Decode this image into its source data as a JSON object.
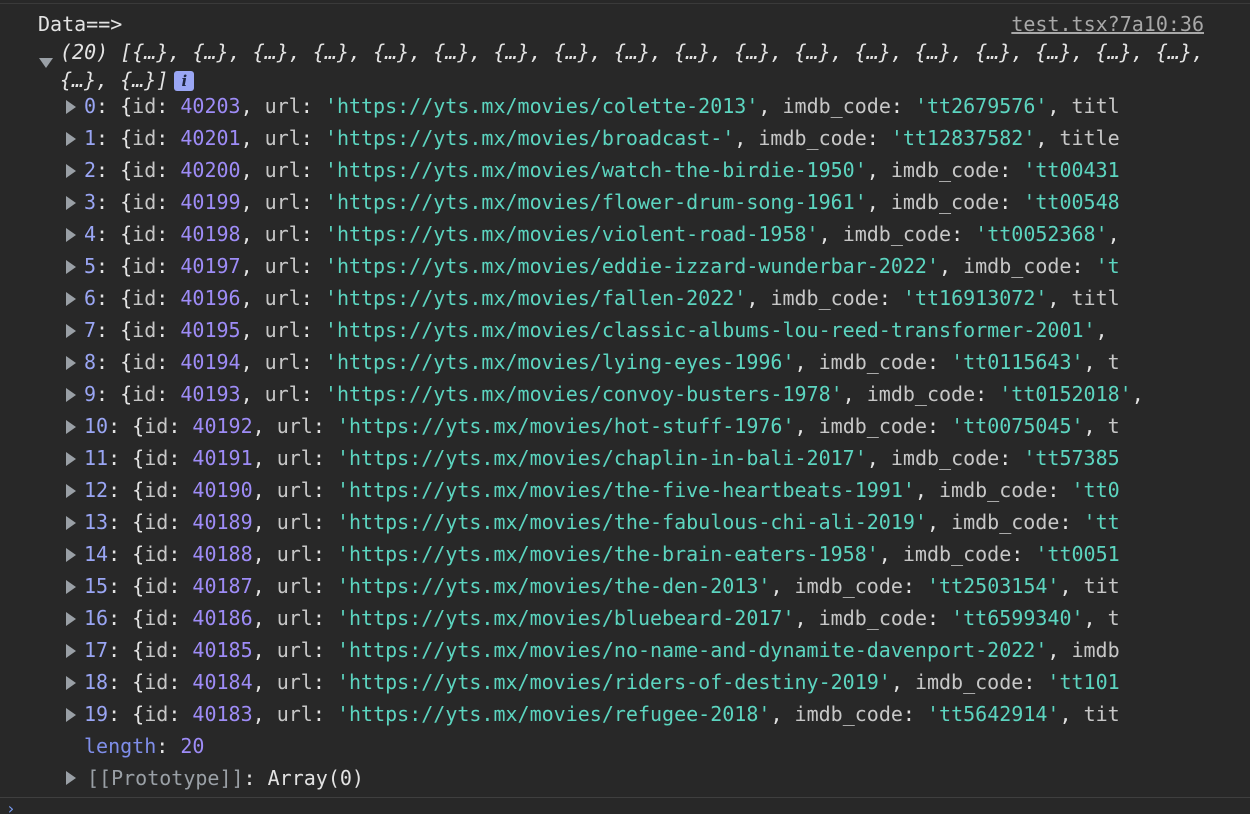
{
  "console": {
    "log_label": "Data==>",
    "source_link": "test.tsx?7a10:36",
    "array_summary": "(20) [{…}, {…}, {…}, {…}, {…}, {…}, {…}, {…}, {…}, {…}, {…}, {…}, {…}, {…}, {…}, {…}, {…}, {…}, {…}, {…}]",
    "info_icon": "info-icon",
    "prompt_icon": "chevron-right-icon",
    "items": [
      {
        "index": "0",
        "id": "40203",
        "url": "https://yts.mx/movies/colette-2013",
        "imdb_code": "tt2679576",
        "tail": "titl"
      },
      {
        "index": "1",
        "id": "40201",
        "url": "https://yts.mx/movies/broadcast-",
        "imdb_code": "tt12837582",
        "tail": "title"
      },
      {
        "index": "2",
        "id": "40200",
        "url": "https://yts.mx/movies/watch-the-birdie-1950",
        "imdb_code": "tt00431",
        "tail": ""
      },
      {
        "index": "3",
        "id": "40199",
        "url": "https://yts.mx/movies/flower-drum-song-1961",
        "imdb_code": "tt00548",
        "tail": ""
      },
      {
        "index": "4",
        "id": "40198",
        "url": "https://yts.mx/movies/violent-road-1958",
        "imdb_code": "tt0052368",
        "tail": ""
      },
      {
        "index": "5",
        "id": "40197",
        "url": "https://yts.mx/movies/eddie-izzard-wunderbar-2022",
        "imdb_code": "t",
        "tail": ""
      },
      {
        "index": "6",
        "id": "40196",
        "url": "https://yts.mx/movies/fallen-2022",
        "imdb_code": "tt16913072",
        "tail": "titl"
      },
      {
        "index": "7",
        "id": "40195",
        "url": "https://yts.mx/movies/classic-albums-lou-reed-transformer-2001",
        "imdb_code": "",
        "tail": ""
      },
      {
        "index": "8",
        "id": "40194",
        "url": "https://yts.mx/movies/lying-eyes-1996",
        "imdb_code": "tt0115643",
        "tail": "t"
      },
      {
        "index": "9",
        "id": "40193",
        "url": "https://yts.mx/movies/convoy-busters-1978",
        "imdb_code": "tt0152018",
        "tail": ""
      },
      {
        "index": "10",
        "id": "40192",
        "url": "https://yts.mx/movies/hot-stuff-1976",
        "imdb_code": "tt0075045",
        "tail": "t"
      },
      {
        "index": "11",
        "id": "40191",
        "url": "https://yts.mx/movies/chaplin-in-bali-2017",
        "imdb_code": "tt57385",
        "tail": ""
      },
      {
        "index": "12",
        "id": "40190",
        "url": "https://yts.mx/movies/the-five-heartbeats-1991",
        "imdb_code": "tt0",
        "tail": ""
      },
      {
        "index": "13",
        "id": "40189",
        "url": "https://yts.mx/movies/the-fabulous-chi-ali-2019",
        "imdb_code": "tt",
        "tail": ""
      },
      {
        "index": "14",
        "id": "40188",
        "url": "https://yts.mx/movies/the-brain-eaters-1958",
        "imdb_code": "tt0051",
        "tail": ""
      },
      {
        "index": "15",
        "id": "40187",
        "url": "https://yts.mx/movies/the-den-2013",
        "imdb_code": "tt2503154",
        "tail": "tit"
      },
      {
        "index": "16",
        "id": "40186",
        "url": "https://yts.mx/movies/bluebeard-2017",
        "imdb_code": "tt6599340",
        "tail": "t"
      },
      {
        "index": "17",
        "id": "40185",
        "url": "https://yts.mx/movies/no-name-and-dynamite-davenport-2022",
        "imdb_code": "",
        "tail": "imdb"
      },
      {
        "index": "18",
        "id": "40184",
        "url": "https://yts.mx/movies/riders-of-destiny-2019",
        "imdb_code": "tt101",
        "tail": ""
      },
      {
        "index": "19",
        "id": "40183",
        "url": "https://yts.mx/movies/refugee-2018",
        "imdb_code": "tt5642914",
        "tail": "tit"
      }
    ],
    "length_key": "length",
    "length_value": "20",
    "prototype_key": "[[Prototype]]",
    "prototype_value": "Array(0)"
  },
  "colors": {
    "background": "#282828",
    "string": "#5cd5c0",
    "number": "#9e8cf7",
    "index_key": "#9aa6f4"
  }
}
